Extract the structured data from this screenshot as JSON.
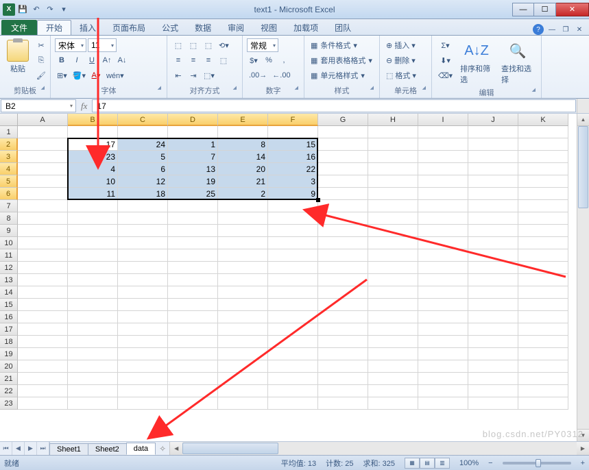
{
  "title": "text1 - Microsoft Excel",
  "qat": {
    "save": "💾",
    "undo": "↶",
    "redo": "↷"
  },
  "tabs": {
    "file": "文件",
    "items": [
      "开始",
      "插入",
      "页面布局",
      "公式",
      "数据",
      "审阅",
      "视图",
      "加载项",
      "团队"
    ],
    "active": 0
  },
  "ribbon": {
    "clipboard": {
      "label": "剪贴板",
      "paste": "粘贴"
    },
    "font": {
      "label": "字体",
      "name": "宋体",
      "size": "11"
    },
    "align": {
      "label": "对齐方式"
    },
    "number": {
      "label": "数字",
      "format": "常规"
    },
    "styles": {
      "label": "样式",
      "cond": "条件格式",
      "table": "套用表格格式",
      "cell": "单元格样式"
    },
    "cells": {
      "label": "单元格",
      "insert": "插入",
      "delete": "删除",
      "format": "格式"
    },
    "editing": {
      "label": "编辑",
      "sort": "排序和筛选",
      "find": "查找和选择"
    }
  },
  "namebox": "B2",
  "formula": "17",
  "columns": [
    "A",
    "B",
    "C",
    "D",
    "E",
    "F",
    "G",
    "H",
    "I",
    "J",
    "K"
  ],
  "sel_cols": [
    1,
    2,
    3,
    4,
    5
  ],
  "rows_count": 23,
  "sel_rows": [
    2,
    3,
    4,
    5,
    6
  ],
  "active_cell": {
    "r": 2,
    "c": 1
  },
  "chart_data": {
    "type": "table",
    "columns": [
      "B",
      "C",
      "D",
      "E",
      "F"
    ],
    "rows": [
      "2",
      "3",
      "4",
      "5",
      "6"
    ],
    "values": [
      [
        17,
        24,
        1,
        8,
        15
      ],
      [
        23,
        5,
        7,
        14,
        16
      ],
      [
        4,
        6,
        13,
        20,
        22
      ],
      [
        10,
        12,
        19,
        21,
        3
      ],
      [
        11,
        18,
        25,
        2,
        9
      ]
    ]
  },
  "sheets": {
    "items": [
      "Sheet1",
      "Sheet2",
      "data"
    ],
    "active": 2
  },
  "status": {
    "ready": "就绪",
    "avg_label": "平均值:",
    "avg": "13",
    "count_label": "计数:",
    "count": "25",
    "sum_label": "求和:",
    "sum": "325",
    "zoom": "100%"
  },
  "watermark": "blog.csdn.net/PY0312"
}
